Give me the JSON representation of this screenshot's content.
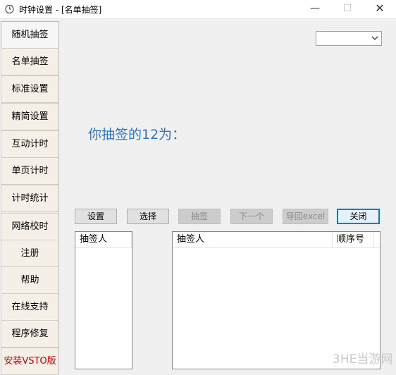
{
  "window": {
    "title": "时钟设置 - [名单抽签]",
    "minimize": "—",
    "maximize": "☐",
    "close": "✕"
  },
  "sidebar": {
    "items": [
      {
        "label": "随机抽签"
      },
      {
        "label": "名单抽签"
      },
      {
        "label": "标准设置"
      },
      {
        "label": "精简设置"
      },
      {
        "label": "互动计时"
      },
      {
        "label": "单页计时"
      },
      {
        "label": "计时统计"
      },
      {
        "label": "网络校时"
      },
      {
        "label": "注册"
      },
      {
        "label": "帮助"
      },
      {
        "label": "在线支持"
      },
      {
        "label": "程序修复"
      },
      {
        "label": "安装VSTO版"
      }
    ],
    "active_index": 0,
    "highlight_color": "#d00000"
  },
  "combo": {
    "value": ""
  },
  "result": {
    "text": "你抽签的12为："
  },
  "toolbar": {
    "settings_label": "设置",
    "select_label": "选择",
    "draw_label": "抽签",
    "next_label": "下一个",
    "export_label": "导回excel",
    "close_label": "关闭"
  },
  "left_list": {
    "header": "抽签人"
  },
  "right_list": {
    "header_name": "抽签人",
    "header_order": "顺序号"
  },
  "watermark": "3HE当游网",
  "colors": {
    "accent": "#2e75c0",
    "focus": "#0078d7"
  }
}
